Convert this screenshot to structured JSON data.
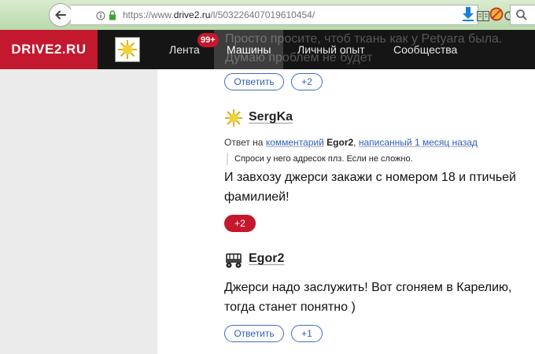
{
  "browser": {
    "url_prefix": "https://www.",
    "url_host": "drive2.ru",
    "url_path": "/l/503226407019610454/"
  },
  "header": {
    "logo": "DRIVE2.RU",
    "nav": [
      {
        "label": "Лента"
      },
      {
        "label": "Машины"
      },
      {
        "label": "Личный опыт"
      },
      {
        "label": "Сообщества"
      }
    ],
    "badge": "99+",
    "overlap_text": "Просто просите, чтоб ткань как у Petyara была. Думаю проблем не будет"
  },
  "comments": {
    "top_actions": {
      "reply": "Ответить",
      "plus": "+2"
    },
    "sergka": {
      "username": "SergKa",
      "reply_prefix": "Ответ на",
      "reply_link": "комментарий",
      "reply_author": "Egor2",
      "reply_sep": ",",
      "reply_time": "написанный 1 месяц назад",
      "quote": "Спроси у него адресок плз. Если не сложно.",
      "text": "И завхозу джерси закажи с номером 18 и птичьей фамилией!",
      "plus": "+2"
    },
    "egor2": {
      "username": "Egor2",
      "text": "Джерси надо заслужить! Вот сгоняем в Карелию, тогда станет понятно )",
      "reply": "Ответить",
      "plus": "+1"
    }
  }
}
